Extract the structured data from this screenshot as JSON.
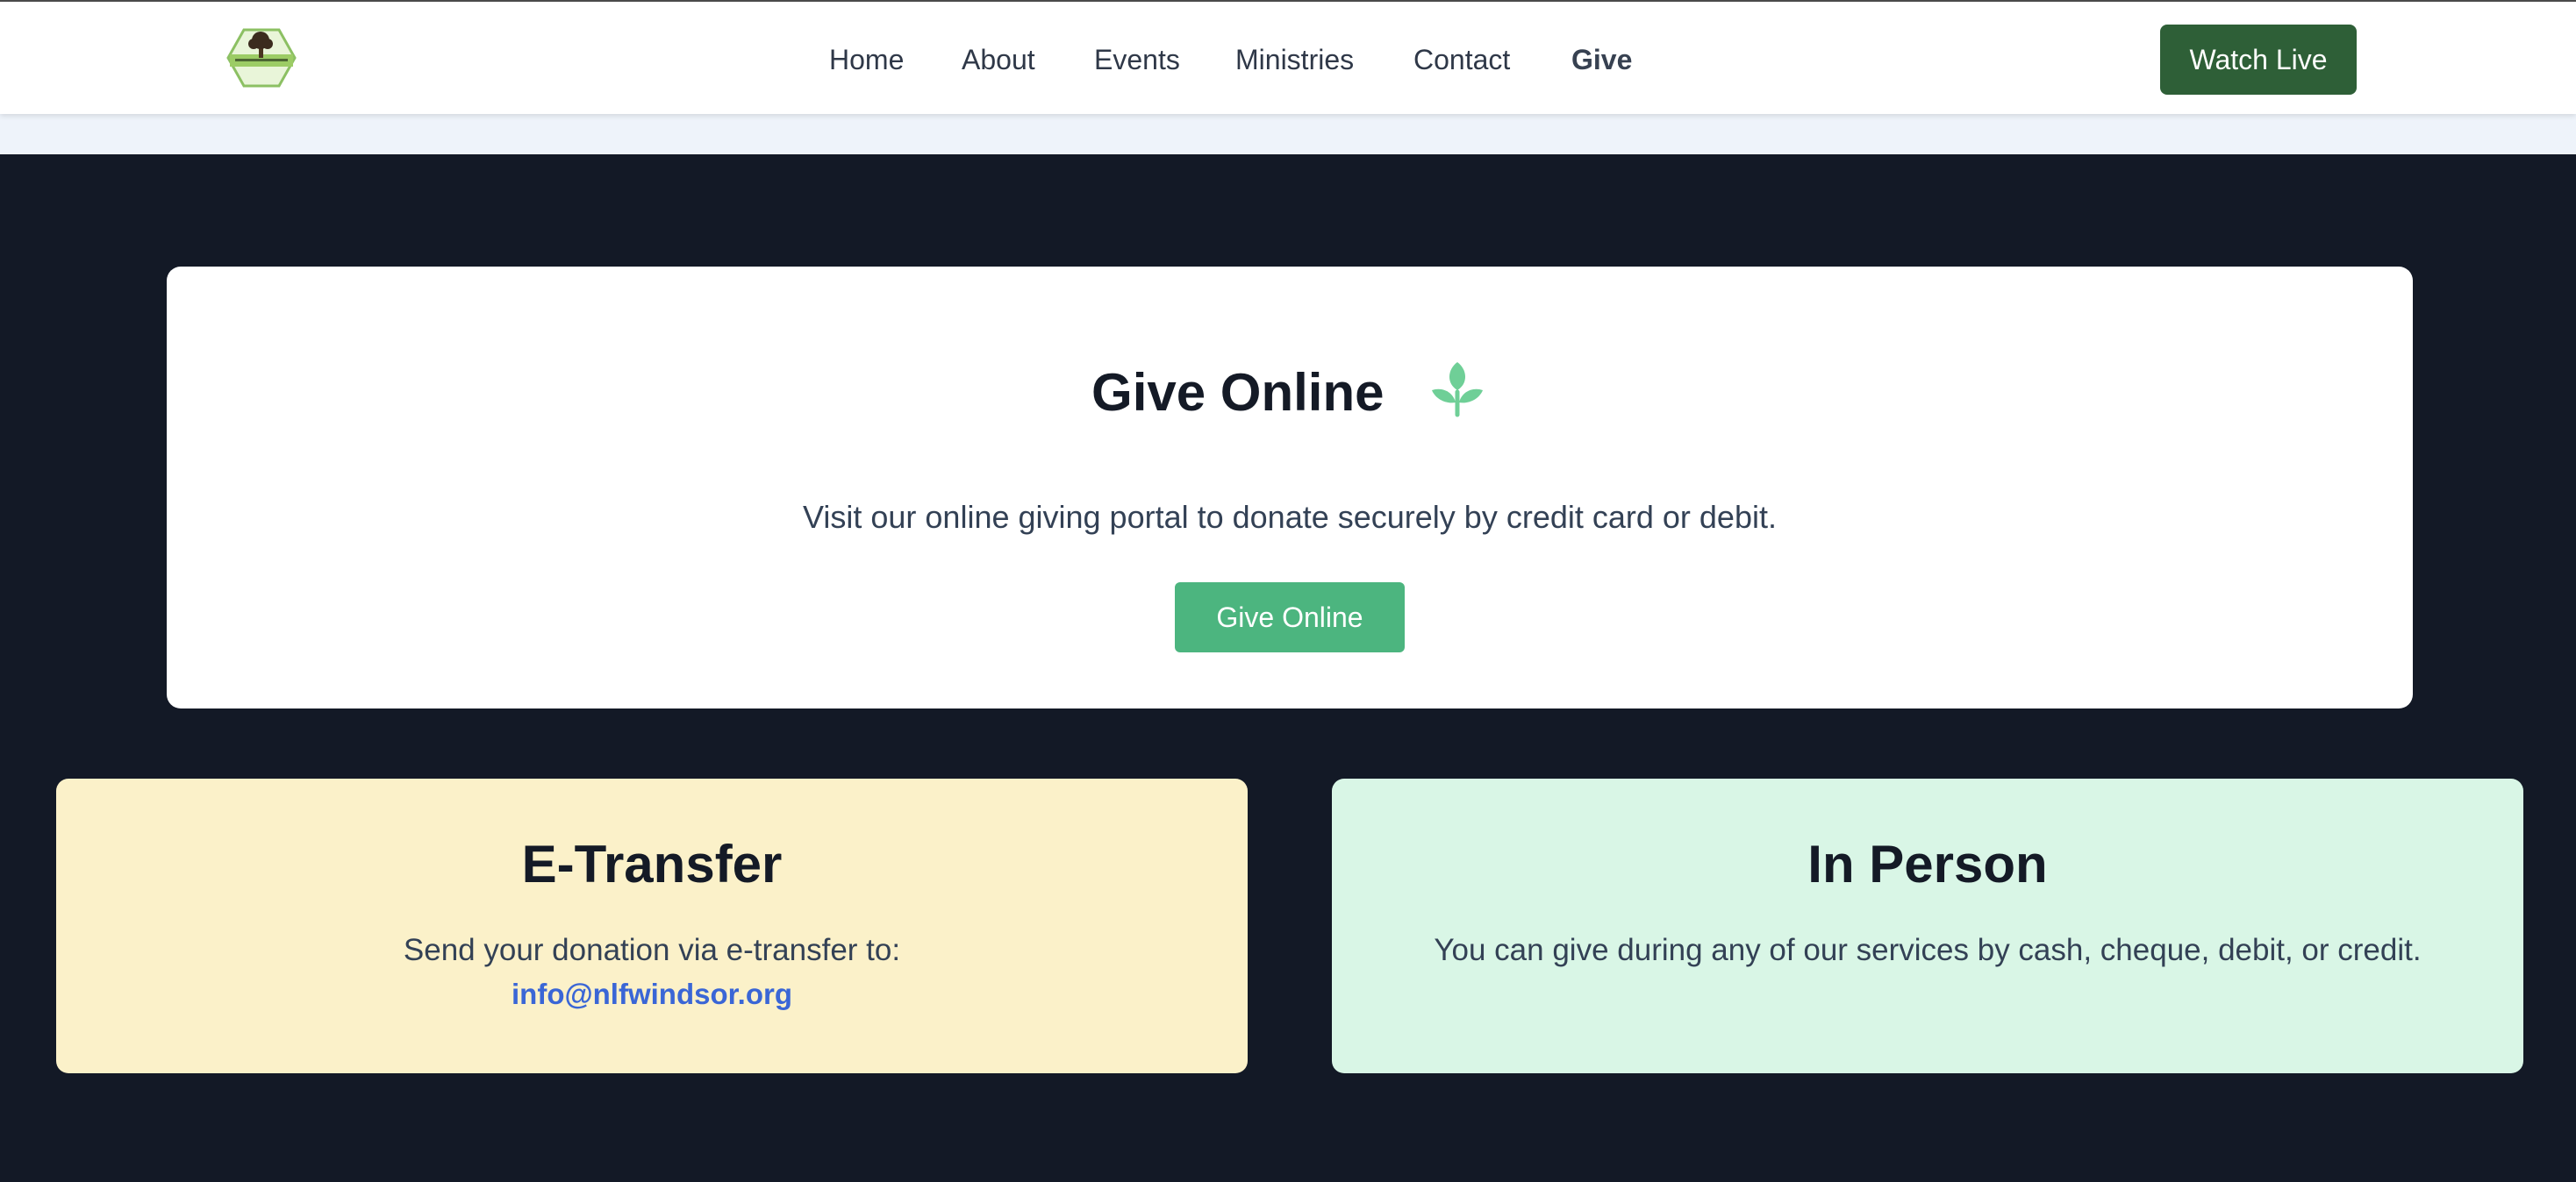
{
  "header": {
    "logo": {
      "alt": "New Life Fellowship",
      "icon": "church-tree-logo"
    },
    "nav": [
      {
        "label": "Home"
      },
      {
        "label": "About"
      },
      {
        "label": "Events"
      },
      {
        "label": "Ministries"
      },
      {
        "label": "Contact"
      },
      {
        "label": "Give",
        "active": true
      }
    ],
    "watch_live_label": "Watch Live"
  },
  "main": {
    "give_online": {
      "title": "Give Online",
      "icon": "sprout-icon",
      "description": "Visit our online giving portal to donate securely by credit card or debit.",
      "button_label": "Give Online"
    },
    "etransfer": {
      "title": "E-Transfer",
      "text": "Send your donation via e-transfer to:",
      "email": "info@nlfwindsor.org"
    },
    "in_person": {
      "title": "In Person",
      "text": "You can give during any of our services by cash, cheque, debit, or credit."
    }
  },
  "colors": {
    "page_bg": "#131926",
    "accent_dark_green": "#2e5f37",
    "give_button_green": "#4cb57f",
    "sprout_green": "#6fcf97",
    "etransfer_bg": "#fbf1c9",
    "in_person_bg": "#d9f6e6",
    "link_blue": "#3a66d6"
  }
}
